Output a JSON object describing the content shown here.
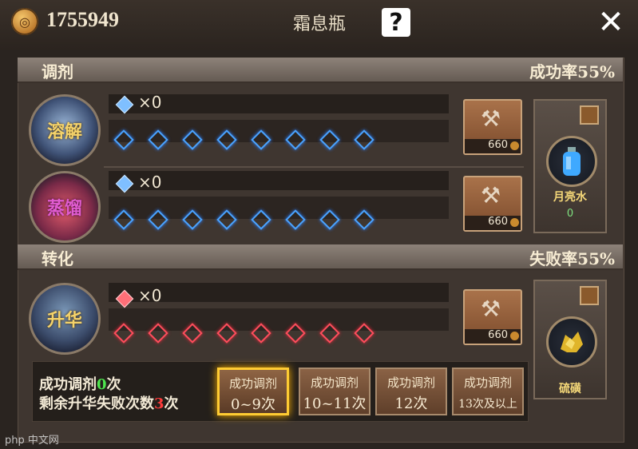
{
  "header": {
    "currency_value": "1755949",
    "title": "霜息瓶",
    "help_label": "?",
    "close_label": "✕"
  },
  "blend": {
    "title": "调剂",
    "rate": "成功率55%",
    "rows": [
      {
        "potion_label": "溶解",
        "count": "×0",
        "cost": "660"
      },
      {
        "potion_label": "蒸馏",
        "count": "×0",
        "cost": "660"
      }
    ],
    "material": {
      "name": "月亮水",
      "qty": "0"
    }
  },
  "transform": {
    "title": "转化",
    "rate": "失败率55%",
    "rows": [
      {
        "potion_label": "升华",
        "count": "×0",
        "cost": "660"
      }
    ],
    "material": {
      "name": "硫磺"
    }
  },
  "stats": {
    "line1_prefix": "成功调剂",
    "line1_value": "0",
    "line1_suffix": "次",
    "line2_prefix": "剩余升华失败次数",
    "line2_value": "3",
    "line2_suffix": "次"
  },
  "tiers": [
    {
      "a": "成功调剂",
      "b": "0~9次",
      "active": true
    },
    {
      "a": "成功调剂",
      "b": "10~11次",
      "active": false
    },
    {
      "a": "成功调剂",
      "b": "12次",
      "active": false
    },
    {
      "a": "成功调剂",
      "b": "13次及以上",
      "active": false
    }
  ],
  "watermark": "php 中文网",
  "colors": {
    "success_green": "#4ee54e",
    "fail_red": "#ff3b3b",
    "active_gold": "#ffcc33"
  }
}
